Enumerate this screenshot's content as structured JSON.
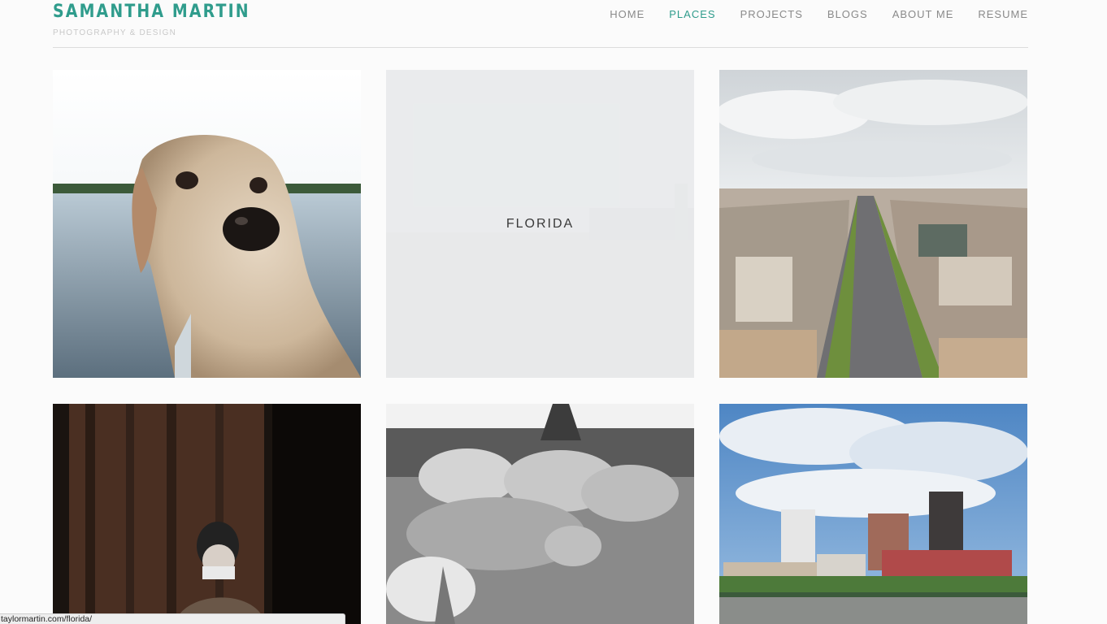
{
  "brand": {
    "name": "SAMANTHA MARTIN",
    "tagline": "PHOTOGRAPHY & DESIGN"
  },
  "nav": {
    "items": [
      "HOME",
      "PLACES",
      "PROJECTS",
      "BLOGS",
      "ABOUT ME",
      "RESUME"
    ],
    "active": "PLACES"
  },
  "gallery": {
    "hover_label": "FLORIDA"
  },
  "status": {
    "url": "taylormartin.com/florida/"
  },
  "colors": {
    "accent": "#2f9c8c",
    "nav_text": "#8a8a8a",
    "background": "#fbfbfb"
  }
}
